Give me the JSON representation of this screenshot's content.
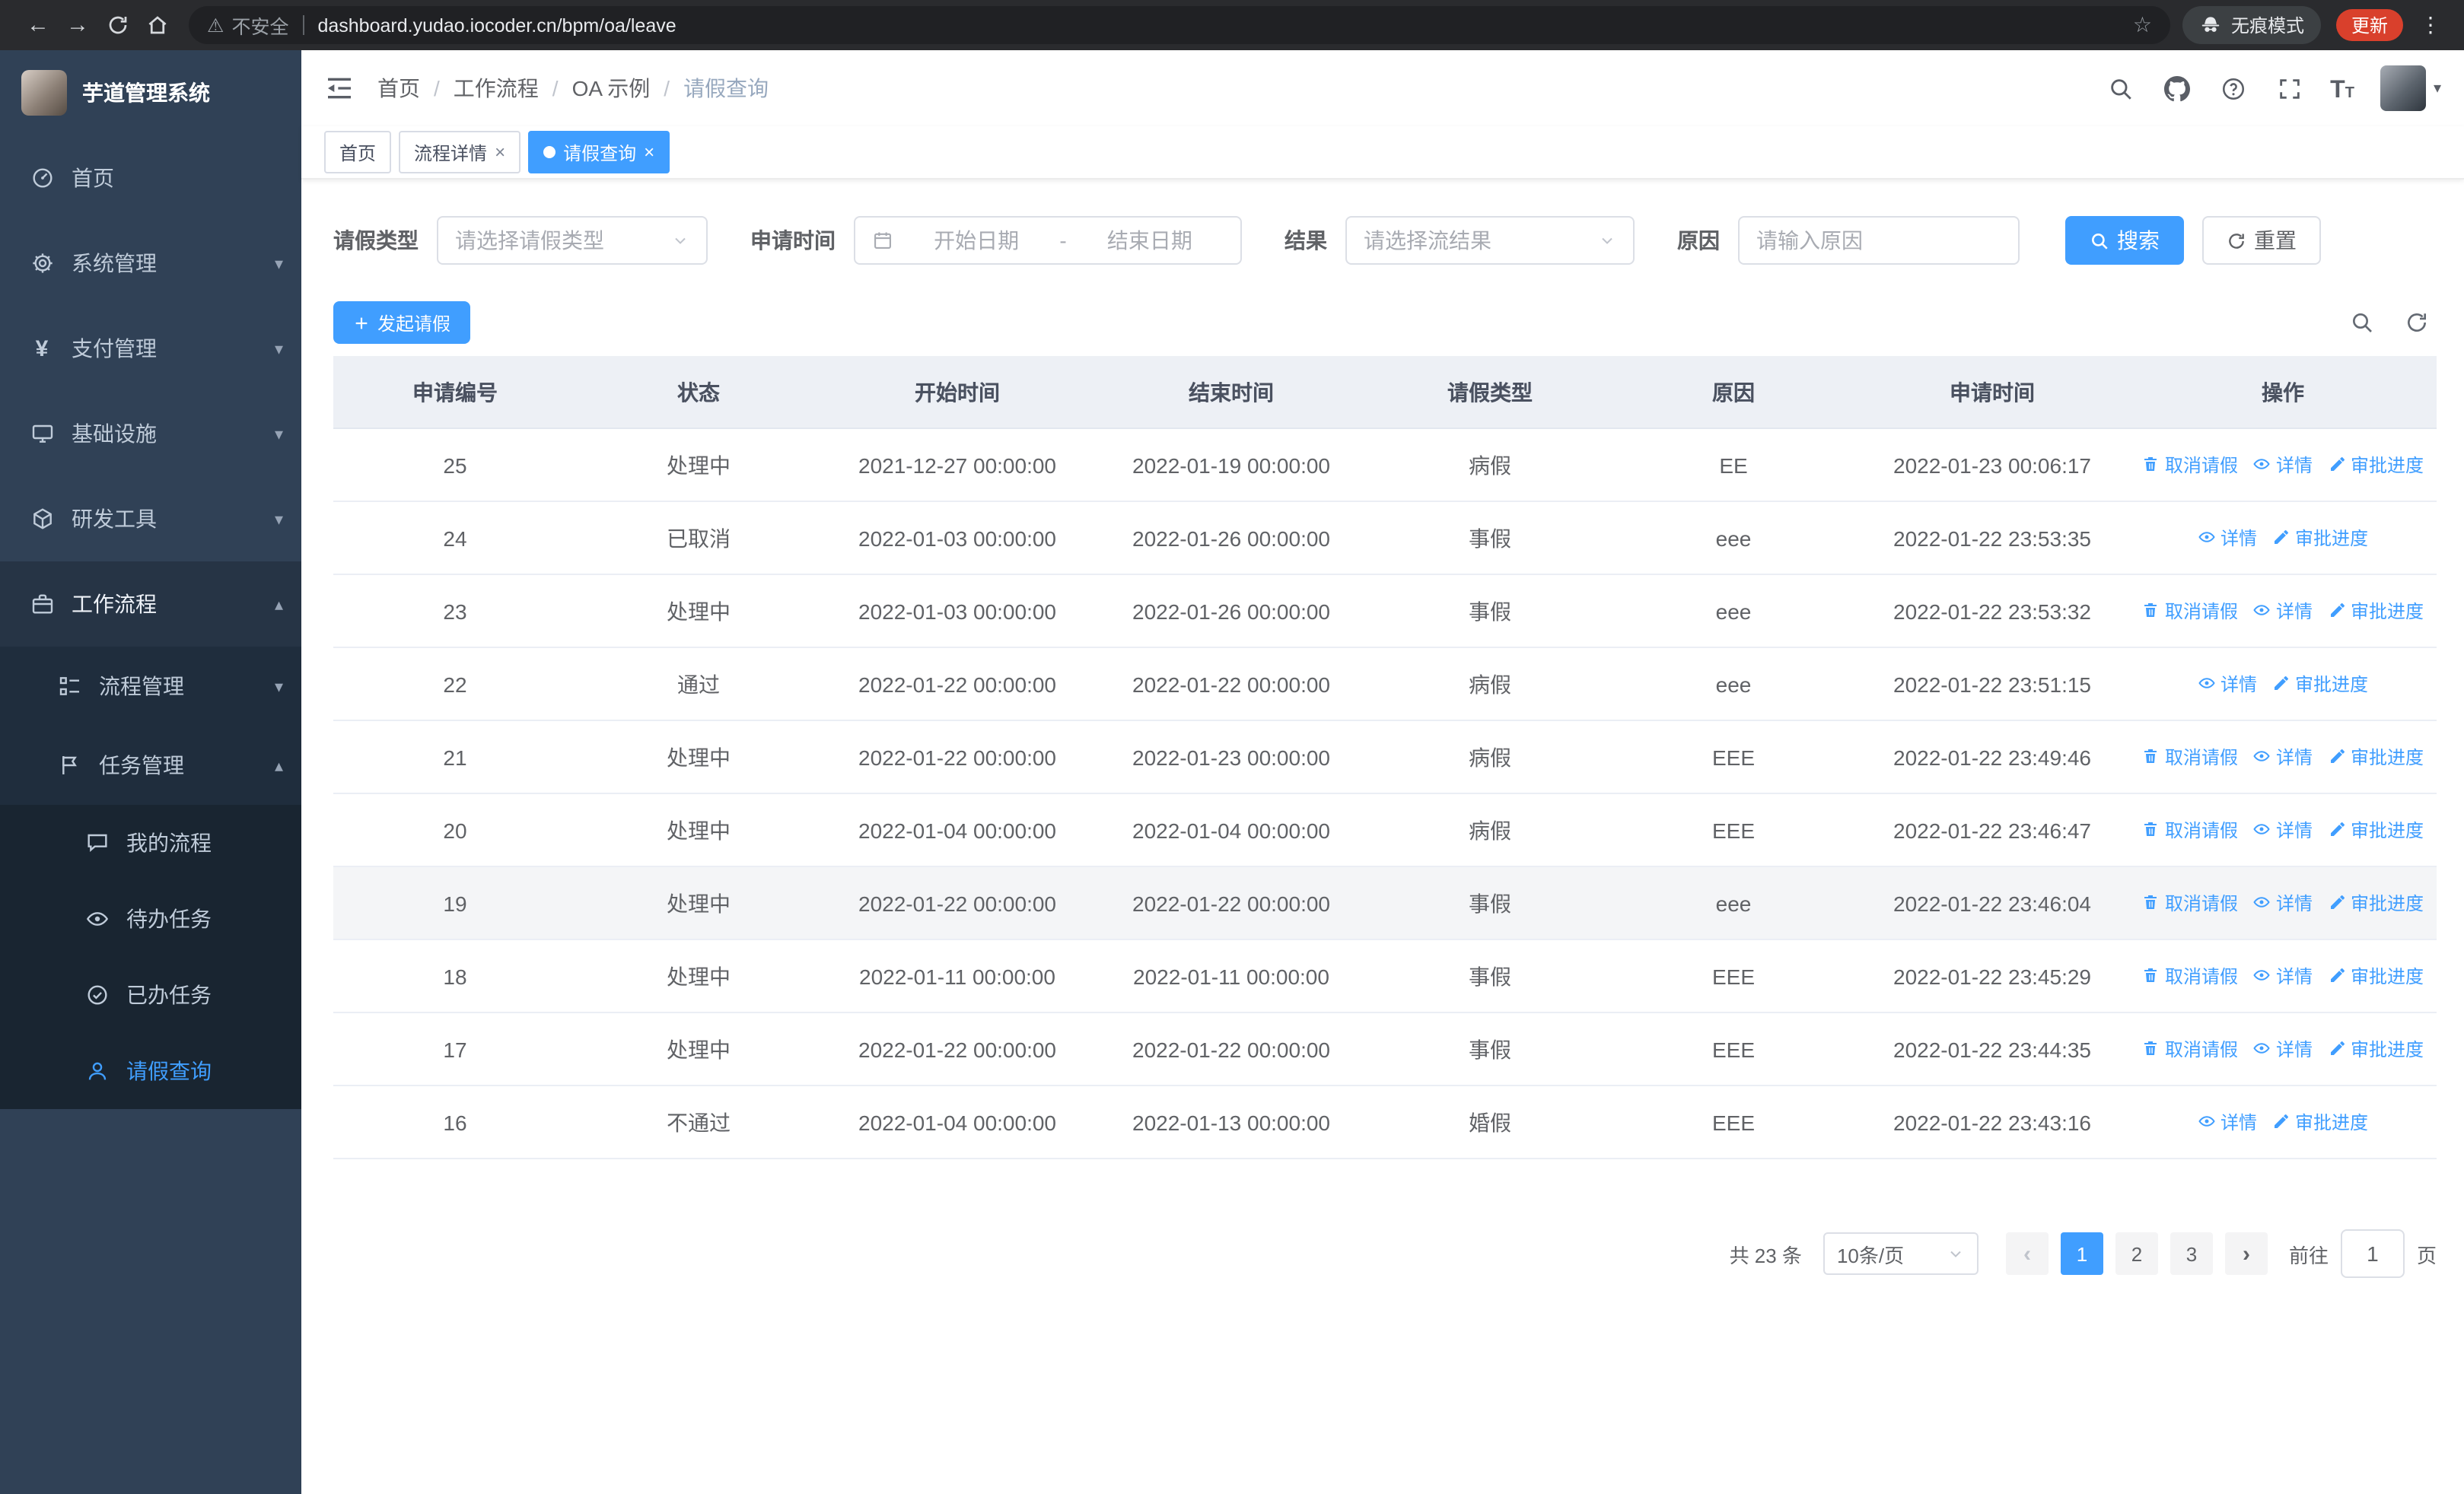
{
  "icons": {
    "back": "←",
    "forward": "→",
    "star": "☆",
    "warning": "⚠",
    "menu_dots": "⋮",
    "caret_down": "▾",
    "caret_up": "▴",
    "yen": "¥",
    "close": "×",
    "prev": "‹",
    "next": "›",
    "fontsize_large": "T",
    "fontsize_small": "T"
  },
  "browser": {
    "security_label": "不安全",
    "url": "dashboard.yudao.iocoder.cn/bpm/oa/leave",
    "incognito_label": "无痕模式",
    "update_label": "更新"
  },
  "sidebar": {
    "logo_title": "芋道管理系统",
    "items": [
      {
        "label": "首页"
      },
      {
        "label": "系统管理"
      },
      {
        "label": "支付管理"
      },
      {
        "label": "基础设施"
      },
      {
        "label": "研发工具"
      },
      {
        "label": "工作流程"
      },
      {
        "label": "流程管理"
      },
      {
        "label": "任务管理"
      },
      {
        "label": "我的流程"
      },
      {
        "label": "待办任务"
      },
      {
        "label": "已办任务"
      },
      {
        "label": "请假查询"
      }
    ]
  },
  "navbar": {
    "breadcrumbs": [
      "首页",
      "工作流程",
      "OA 示例",
      "请假查询"
    ],
    "separator": "/"
  },
  "tabs": {
    "items": [
      {
        "label": "首页"
      },
      {
        "label": "流程详情"
      },
      {
        "label": "请假查询"
      }
    ]
  },
  "filters": {
    "leave_type_label": "请假类型",
    "leave_type_placeholder": "请选择请假类型",
    "apply_time_label": "申请时间",
    "start_placeholder": "开始日期",
    "range_separator": "-",
    "end_placeholder": "结束日期",
    "result_label": "结果",
    "result_placeholder": "请选择流结果",
    "reason_label": "原因",
    "reason_placeholder": "请输入原因",
    "search_label": "搜索",
    "reset_label": "重置"
  },
  "toolbar": {
    "create_label": "发起请假"
  },
  "table": {
    "columns": [
      "申请编号",
      "状态",
      "开始时间",
      "结束时间",
      "请假类型",
      "原因",
      "申请时间",
      "操作"
    ],
    "actions": {
      "cancel": "取消请假",
      "detail": "详情",
      "progress": "审批进度"
    },
    "rows": [
      {
        "id": "25",
        "status": "处理中",
        "start": "2021-12-27 00:00:00",
        "end": "2022-01-19 00:00:00",
        "type": "病假",
        "reason": "EE",
        "applied": "2022-01-23 00:06:17",
        "cancelable": true,
        "highlighted": false
      },
      {
        "id": "24",
        "status": "已取消",
        "start": "2022-01-03 00:00:00",
        "end": "2022-01-26 00:00:00",
        "type": "事假",
        "reason": "eee",
        "applied": "2022-01-22 23:53:35",
        "cancelable": false,
        "highlighted": false
      },
      {
        "id": "23",
        "status": "处理中",
        "start": "2022-01-03 00:00:00",
        "end": "2022-01-26 00:00:00",
        "type": "事假",
        "reason": "eee",
        "applied": "2022-01-22 23:53:32",
        "cancelable": true,
        "highlighted": false
      },
      {
        "id": "22",
        "status": "通过",
        "start": "2022-01-22 00:00:00",
        "end": "2022-01-22 00:00:00",
        "type": "病假",
        "reason": "eee",
        "applied": "2022-01-22 23:51:15",
        "cancelable": false,
        "highlighted": false
      },
      {
        "id": "21",
        "status": "处理中",
        "start": "2022-01-22 00:00:00",
        "end": "2022-01-23 00:00:00",
        "type": "病假",
        "reason": "EEE",
        "applied": "2022-01-22 23:49:46",
        "cancelable": true,
        "highlighted": false
      },
      {
        "id": "20",
        "status": "处理中",
        "start": "2022-01-04 00:00:00",
        "end": "2022-01-04 00:00:00",
        "type": "病假",
        "reason": "EEE",
        "applied": "2022-01-22 23:46:47",
        "cancelable": true,
        "highlighted": false
      },
      {
        "id": "19",
        "status": "处理中",
        "start": "2022-01-22 00:00:00",
        "end": "2022-01-22 00:00:00",
        "type": "事假",
        "reason": "eee",
        "applied": "2022-01-22 23:46:04",
        "cancelable": true,
        "highlighted": true
      },
      {
        "id": "18",
        "status": "处理中",
        "start": "2022-01-11 00:00:00",
        "end": "2022-01-11 00:00:00",
        "type": "事假",
        "reason": "EEE",
        "applied": "2022-01-22 23:45:29",
        "cancelable": true,
        "highlighted": false
      },
      {
        "id": "17",
        "status": "处理中",
        "start": "2022-01-22 00:00:00",
        "end": "2022-01-22 00:00:00",
        "type": "事假",
        "reason": "EEE",
        "applied": "2022-01-22 23:44:35",
        "cancelable": true,
        "highlighted": false
      },
      {
        "id": "16",
        "status": "不通过",
        "start": "2022-01-04 00:00:00",
        "end": "2022-01-13 00:00:00",
        "type": "婚假",
        "reason": "EEE",
        "applied": "2022-01-22 23:43:16",
        "cancelable": false,
        "highlighted": false
      }
    ]
  },
  "pagination": {
    "total": "共 23 条",
    "page_size": "10条/页",
    "pages": [
      "1",
      "2",
      "3"
    ],
    "active_page": "1",
    "goto_label": "前往",
    "goto_value": "1",
    "unit_label": "页"
  }
}
